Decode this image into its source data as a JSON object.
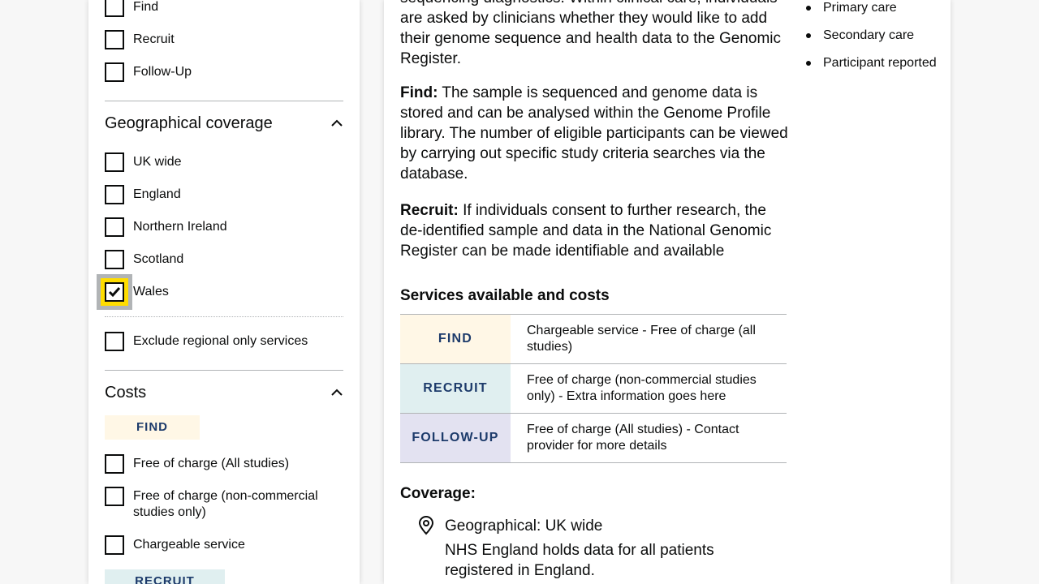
{
  "filters": {
    "stage_options": [
      {
        "label": "Find"
      },
      {
        "label": "Recruit"
      },
      {
        "label": "Follow-Up"
      }
    ],
    "geo": {
      "title": "Geographical coverage",
      "options": [
        {
          "label": "UK wide"
        },
        {
          "label": "England"
        },
        {
          "label": "Northern Ireland"
        },
        {
          "label": "Scotland"
        },
        {
          "label": "Wales",
          "checked": true
        }
      ],
      "exclude_label": "Exclude regional only services"
    },
    "costs": {
      "title": "Costs",
      "find_tag": "FIND",
      "options": [
        {
          "label": "Free of charge (All studies)"
        },
        {
          "label": "Free of charge (non-commercial studies only)"
        },
        {
          "label": "Chargeable service"
        }
      ],
      "recruit_tag": "RECRUIT"
    }
  },
  "main": {
    "intro_partial": "sequencing diagnostics. Within clinical care, individuals are asked by clinicians whether they would like to add their genome sequence and health data to the Genomic Register.",
    "find_label": "Find:",
    "find_text": " The sample is sequenced and genome data is stored and can be analysed within the Genome Profile library. The number of eligible participants can be viewed by carrying out specific study criteria searches via the database.",
    "recruit_label": "Recruit:",
    "recruit_text": " If individuals consent to further research, the de-identified sample and data in the National Genomic Register can be made identifiable and available",
    "services_heading": "Services available and costs",
    "services": [
      {
        "tag": "FIND",
        "text": "Chargeable service - Free of charge (all studies)"
      },
      {
        "tag": "RECRUIT",
        "text": "Free of charge (non-commercial studies only) - Extra information goes here"
      },
      {
        "tag": "FOLLOW-UP",
        "text": "Free of charge (All studies) - Contact provider for more details"
      }
    ],
    "coverage_heading": "Coverage:",
    "coverage_geo": "Geographical: UK wide",
    "coverage_desc": "NHS England holds data for all patients registered in England."
  },
  "side": {
    "items": [
      "Primary care",
      "Secondary care",
      "Participant reported"
    ]
  },
  "colors": {
    "find_bg": "#fff7e6",
    "recruit_bg": "#e0eff0",
    "followup_bg": "#e3e2f1",
    "tag_text": "#1d3b6b",
    "focus": "#ffdd00"
  }
}
